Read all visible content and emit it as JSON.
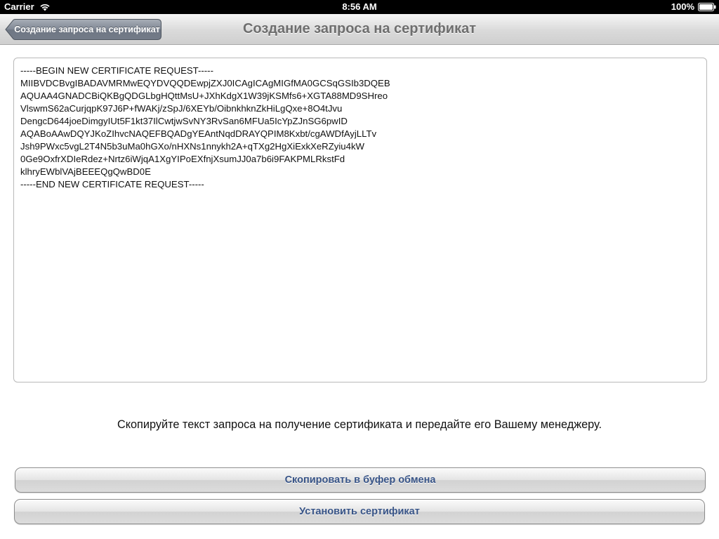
{
  "status_bar": {
    "carrier": "Carrier",
    "time": "8:56 AM",
    "battery": "100%",
    "icons": [
      "wifi-icon",
      "battery-icon"
    ]
  },
  "nav_bar": {
    "back_label": "Создание запроса на сертификат",
    "title": "Создание запроса на сертификат"
  },
  "request_text": "-----BEGIN NEW CERTIFICATE REQUEST-----\nMIIBVDCBvgIBADAVMRMwEQYDVQQDEwpjZXJ0ICAgICAgMIGfMA0GCSqGSIb3DQEB\nAQUAA4GNADCBiQKBgQDGLbgHQttMsU+JXhKdgX1W39jKSMfs6+XGTA88MD9SHreo\nVlswmS62aCurjqpK97J6P+fWAKj/zSpJ/6XEYb/OibnkhknZkHiLgQxe+8O4tJvu\nDengcD644joeDimgyIUt5F1kt37IlCwtjwSvNY3RvSan6MFUa5IcYpZJnSG6pwID\nAQABoAAwDQYJKoZIhvcNAQEFBQADgYEAntNqdDRAYQPIM8Kxbt/cgAWDfAyjLLTv\nJsh9PWxc5vgL2T4N5b3uMa0hGXo/nHXNs1nnykh2A+qTXg2HgXiExkXeRZyiu4kW\n0Ge9OxfrXDIeRdez+Nrtz6iWjqA1XgYIPoEXfnjXsumJJ0a7b6i9FAKPMLRkstFd\nklhryEWblVAjBEEEQgQwBD0E\n-----END NEW CERTIFICATE REQUEST-----",
  "instruction": "Скопируйте текст запроса на получение сертификата и передайте его Вашему менеджеру.",
  "buttons": {
    "copy_label": "Скопировать в буфер обмена",
    "install_label": "Установить сертификат"
  },
  "colors": {
    "button_text": "#385487",
    "back_button": "#7d8591"
  }
}
